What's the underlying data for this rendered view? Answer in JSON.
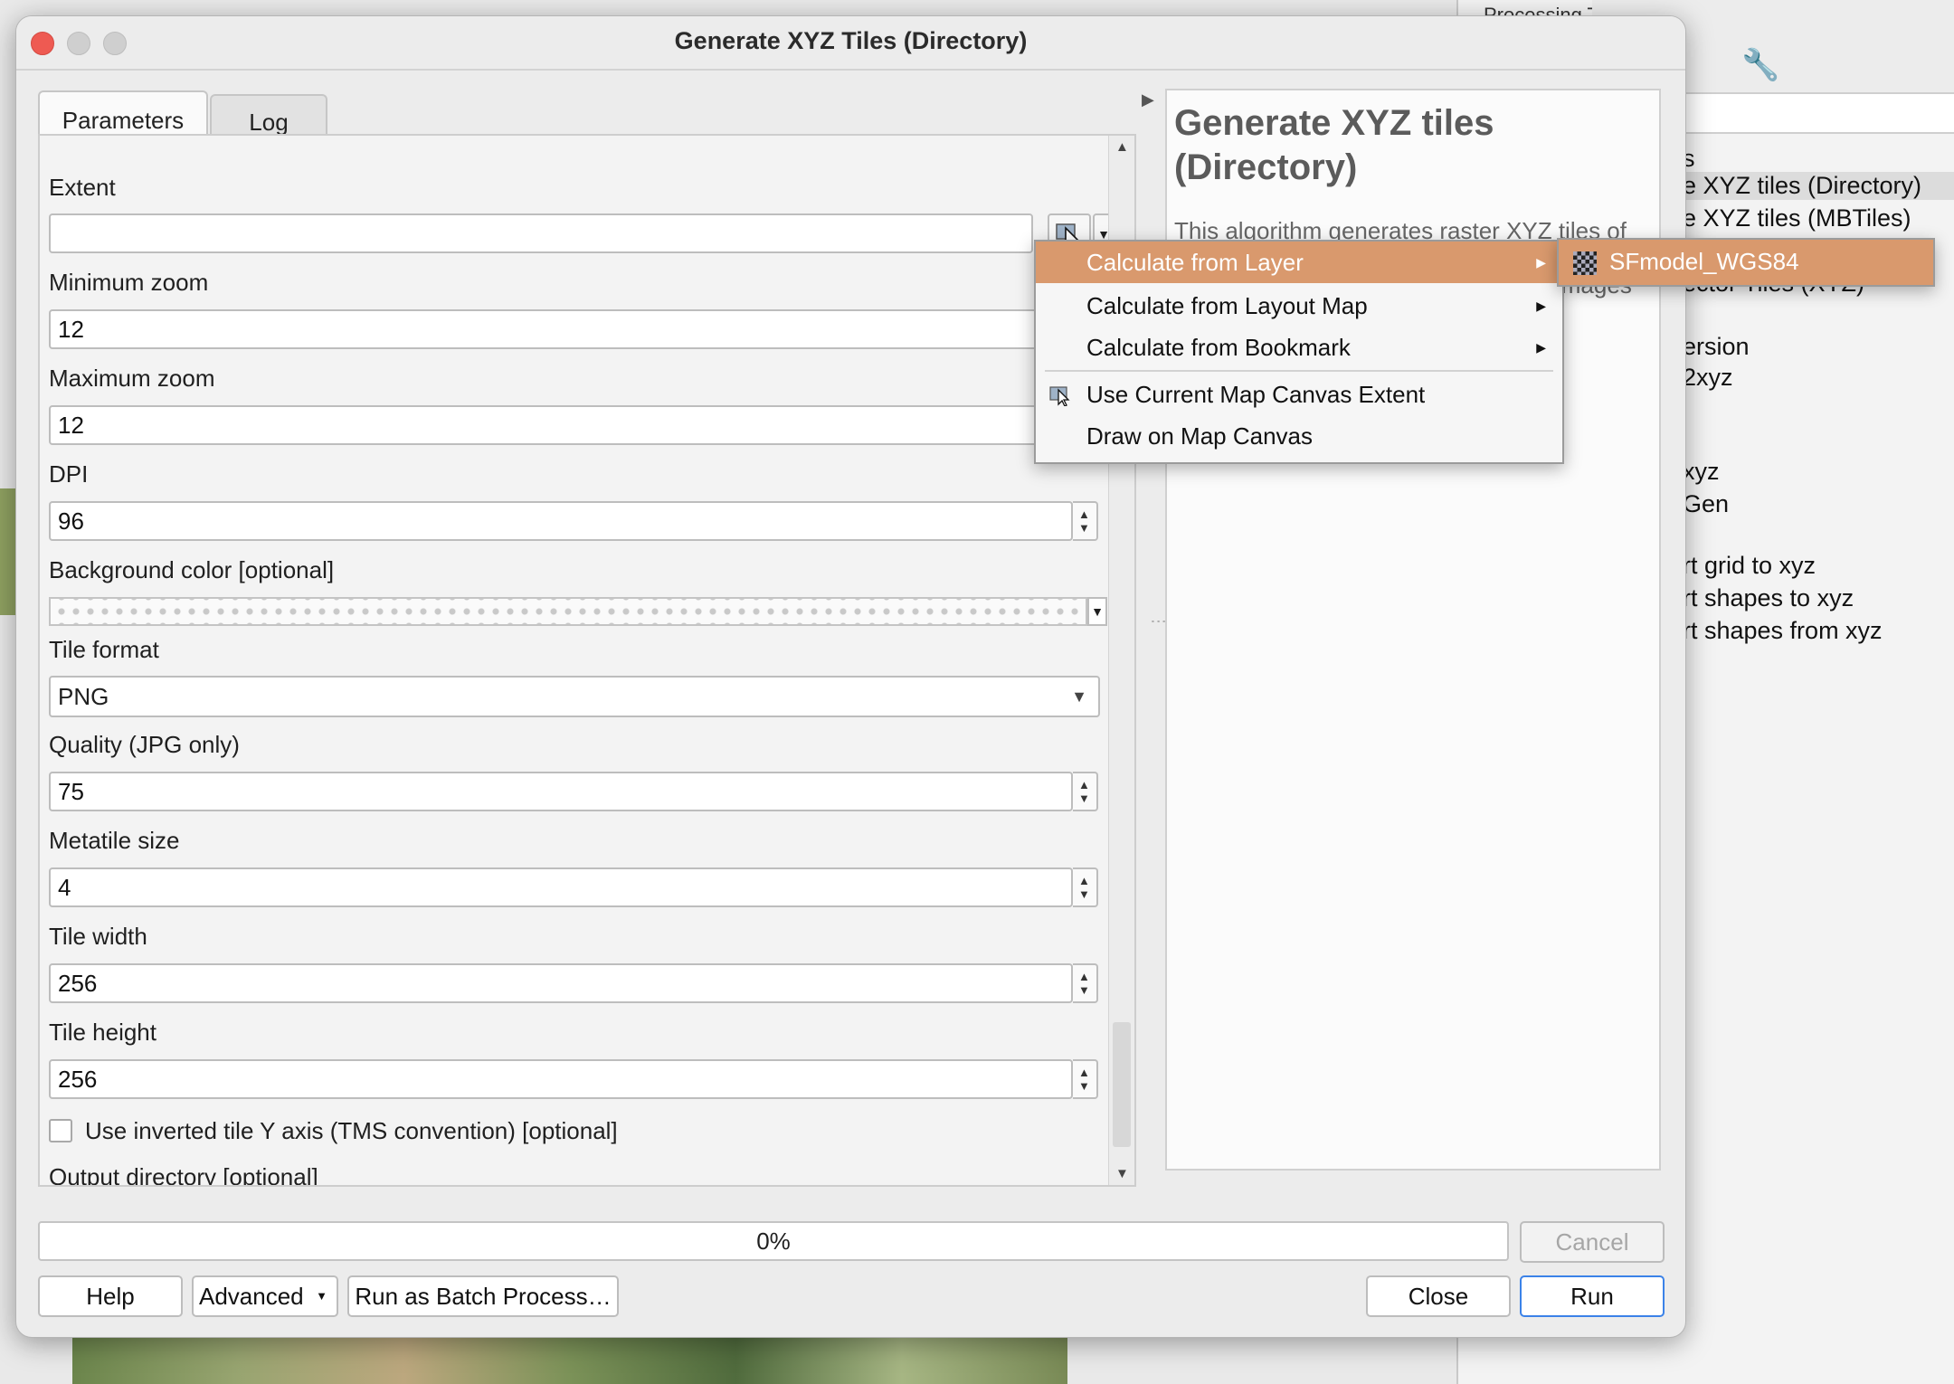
{
  "background": {
    "toolbox_title": "Processing Toolbo",
    "tree_items": [
      {
        "label": "s",
        "selected": false
      },
      {
        "label": "e XYZ tiles (Directory)",
        "selected": true
      },
      {
        "label": "e XYZ tiles (MBTiles)",
        "selected": false
      },
      {
        "label": "ector Tiles (XYZ)",
        "selected": false
      },
      {
        "label": "ersion",
        "selected": false
      },
      {
        "label": "2xyz",
        "selected": false
      },
      {
        "label": "xyz",
        "selected": false
      },
      {
        "label": "Gen",
        "selected": false
      },
      {
        "label": "rt grid to xyz",
        "selected": false
      },
      {
        "label": "rt shapes to xyz",
        "selected": false
      },
      {
        "label": "rt shapes from xyz",
        "selected": false
      }
    ]
  },
  "window": {
    "title": "Generate XYZ Tiles (Directory)"
  },
  "tabs": {
    "parameters": "Parameters",
    "log": "Log"
  },
  "params": {
    "extent": {
      "label": "Extent",
      "value": ""
    },
    "min_zoom": {
      "label": "Minimum zoom",
      "value": "12"
    },
    "max_zoom": {
      "label": "Maximum zoom",
      "value": "12"
    },
    "dpi": {
      "label": "DPI",
      "value": "96"
    },
    "background_color": {
      "label": "Background color [optional]"
    },
    "tile_format": {
      "label": "Tile format",
      "value": "PNG"
    },
    "quality": {
      "label": "Quality (JPG only)",
      "value": "75"
    },
    "metatile": {
      "label": "Metatile size",
      "value": "4"
    },
    "tile_width": {
      "label": "Tile width",
      "value": "256"
    },
    "tile_height": {
      "label": "Tile height",
      "value": "256"
    },
    "inverted": {
      "label": "Use inverted tile Y axis (TMS convention) [optional]",
      "checked": false
    },
    "output_dir": {
      "label": "Output directory [optional]"
    }
  },
  "help": {
    "title": "Generate XYZ tiles (Directory)",
    "text": "This algorithm generates raster XYZ tiles of",
    "text2_partial": "images"
  },
  "menu": {
    "items": [
      {
        "label": "Calculate from Layer",
        "has_submenu": true,
        "highlighted": true
      },
      {
        "label": "Calculate from Layout Map",
        "has_submenu": true
      },
      {
        "label": "Calculate from Bookmark",
        "has_submenu": true
      },
      {
        "label": "Use Current Map Canvas Extent",
        "icon": "map-canvas-extent-icon"
      },
      {
        "label": "Draw on Map Canvas"
      }
    ],
    "submenu_item": "SFmodel_WGS84"
  },
  "footer": {
    "progress": "0%",
    "progress_value": 0,
    "cancel": "Cancel",
    "help": "Help",
    "advanced": "Advanced",
    "batch": "Run as Batch Process…",
    "close": "Close",
    "run": "Run"
  },
  "colors": {
    "highlight": "#d9996d",
    "close_dot": "#ee5a52",
    "default_button_border": "#3b82e8"
  }
}
